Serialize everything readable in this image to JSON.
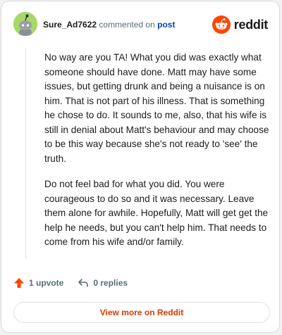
{
  "header": {
    "username": "Sure_Ad7622",
    "action_text": "commented on",
    "post_link": "post",
    "brand": "reddit"
  },
  "comment": {
    "paragraphs": [
      "No way are you TA! What you did was exactly what someone should have done. Matt may have some issues, but getting drunk and being a nuisance is on him. That is not part of his illness. That is something he chose to do. It sounds to me, also, that his wife is still in denial about Matt's behaviour and may choose to be this way because she's not ready to 'see' the truth.",
      "Do not feel bad for what you did. You were courageous to do so and it was necessary. Leave them alone for awhile. Hopefully, Matt will get get the help he needs, but you can't help him. That needs to come from his wife and/or family."
    ]
  },
  "actions": {
    "upvote_label": "1 upvote",
    "replies_label": "0 replies"
  },
  "footer": {
    "view_more_label": "View more on Reddit"
  },
  "colors": {
    "brand_orange": "#ff4500",
    "link_blue": "#0045ac",
    "view_more": "#d93a00"
  },
  "icons": {
    "avatar": "snoo-avatar",
    "logo": "reddit-logo-icon",
    "upvote": "upvote-arrow-icon",
    "reply": "reply-arrow-icon"
  }
}
